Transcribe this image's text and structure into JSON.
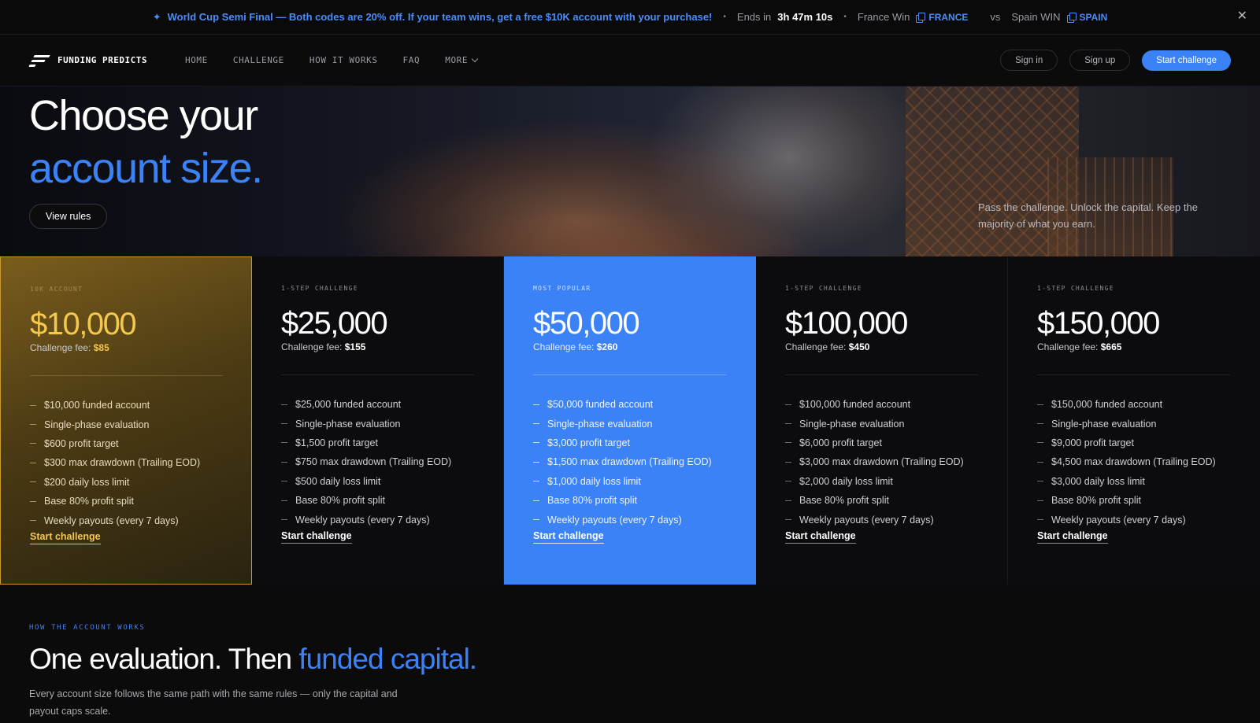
{
  "promo": {
    "message": "World Cup Semi Final — Both codes are 20% off. If your team wins, get a free $10K account with your purchase!",
    "ends_label": "Ends in",
    "timer": "3h 47m 10s",
    "team1_label": "France Win",
    "team1_code": "FRANCE",
    "vs": "vs",
    "team2_label": "Spain WIN",
    "team2_code": "SPAIN",
    "close_glyph": "✕"
  },
  "nav": {
    "brand": "FUNDING PREDICTS",
    "links": [
      "HOME",
      "CHALLENGE",
      "HOW IT WORKS",
      "FAQ",
      "MORE"
    ],
    "sign_in": "Sign in",
    "sign_up": "Sign up",
    "cta": "Start challenge"
  },
  "hero": {
    "title_line1": "Choose your",
    "title_line2": "account size.",
    "view_rules": "View rules",
    "tagline": "Pass the challenge. Unlock the capital. Keep the majority of what you earn."
  },
  "plans": [
    {
      "tag": "10K ACCOUNT",
      "price": "$10,000",
      "fee_label": "Challenge fee:",
      "fee": "$85",
      "features": [
        "$10,000 funded account",
        "Single-phase evaluation",
        "$600 profit target",
        "$300 max drawdown (Trailing EOD)",
        "$200 daily loss limit",
        "Base 80% profit split",
        "Weekly payouts (every 7 days)"
      ],
      "cta": "Start challenge"
    },
    {
      "tag": "1-STEP CHALLENGE",
      "price": "$25,000",
      "fee_label": "Challenge fee:",
      "fee": "$155",
      "features": [
        "$25,000 funded account",
        "Single-phase evaluation",
        "$1,500 profit target",
        "$750 max drawdown (Trailing EOD)",
        "$500 daily loss limit",
        "Base 80% profit split",
        "Weekly payouts (every 7 days)"
      ],
      "cta": "Start challenge"
    },
    {
      "tag": "MOST POPULAR",
      "price": "$50,000",
      "fee_label": "Challenge fee:",
      "fee": "$260",
      "features": [
        "$50,000 funded account",
        "Single-phase evaluation",
        "$3,000 profit target",
        "$1,500 max drawdown (Trailing EOD)",
        "$1,000 daily loss limit",
        "Base 80% profit split",
        "Weekly payouts (every 7 days)"
      ],
      "cta": "Start challenge"
    },
    {
      "tag": "1-STEP CHALLENGE",
      "price": "$100,000",
      "fee_label": "Challenge fee:",
      "fee": "$450",
      "features": [
        "$100,000 funded account",
        "Single-phase evaluation",
        "$6,000 profit target",
        "$3,000 max drawdown (Trailing EOD)",
        "$2,000 daily loss limit",
        "Base 80% profit split",
        "Weekly payouts (every 7 days)"
      ],
      "cta": "Start challenge"
    },
    {
      "tag": "1-STEP CHALLENGE",
      "price": "$150,000",
      "fee_label": "Challenge fee:",
      "fee": "$665",
      "features": [
        "$150,000 funded account",
        "Single-phase evaluation",
        "$9,000 profit target",
        "$4,500 max drawdown (Trailing EOD)",
        "$3,000 daily loss limit",
        "Base 80% profit split",
        "Weekly payouts (every 7 days)"
      ],
      "cta": "Start challenge"
    }
  ],
  "how": {
    "eyebrow": "HOW THE ACCOUNT WORKS",
    "title_part1": "One evaluation. Then ",
    "title_accent": "funded capital.",
    "body": "Every account size follows the same path with the same rules — only the capital and payout caps scale."
  },
  "colors": {
    "accent": "#3b82f6",
    "gold": "#f3c84d",
    "background": "#0b0b0c"
  },
  "icons": {
    "promo": "sparkle-icon",
    "code": "copy-icon",
    "close": "close-icon",
    "more": "chevron-down-icon"
  }
}
